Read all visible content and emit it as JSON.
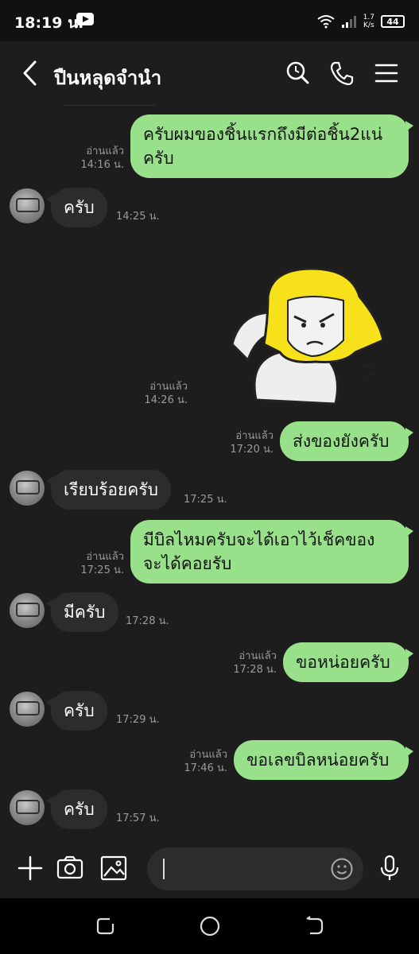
{
  "status_bar": {
    "time": "18:19 น.",
    "speed_value": "1.7",
    "speed_unit": "K/s",
    "battery": "44"
  },
  "header": {
    "title": "ปืนหลุดจำนำ"
  },
  "messages": [
    {
      "id": "m1",
      "from": "me",
      "lines": [
        "ครับผมของชิ้นแรกถึงมีต่อชิ้น2แน่",
        "ครับ"
      ],
      "read": "อ่านแล้ว",
      "time": "14:16 น."
    },
    {
      "id": "m2",
      "from": "them",
      "text": "ครับ",
      "time": "14:25 น."
    },
    {
      "id": "m3",
      "from": "me",
      "type": "sticker",
      "read": "อ่านแล้ว",
      "time": "14:26 น."
    },
    {
      "id": "m4",
      "from": "me",
      "text": "ส่งของยังครับ",
      "read": "อ่านแล้ว",
      "time": "17:20 น."
    },
    {
      "id": "m5",
      "from": "them",
      "text": "เรียบร้อยครับ",
      "time": "17:25 น."
    },
    {
      "id": "m6",
      "from": "me",
      "lines": [
        "มีบิลไหมครับจะได้เอาไว้เช็คของ",
        "จะได้คอยรับ"
      ],
      "read": "อ่านแล้ว",
      "time": "17:25 น."
    },
    {
      "id": "m7",
      "from": "them",
      "text": "มีครับ",
      "time": "17:28 น."
    },
    {
      "id": "m8",
      "from": "me",
      "text": "ขอหน่อยครับ",
      "read": "อ่านแล้ว",
      "time": "17:28 น."
    },
    {
      "id": "m9",
      "from": "them",
      "text": "ครับ",
      "time": "17:29 น."
    },
    {
      "id": "m10",
      "from": "me",
      "text": "ขอเลขบิลหน่อยครับ",
      "read": "อ่านแล้ว",
      "time": "17:46 น."
    },
    {
      "id": "m11",
      "from": "them",
      "text": "ครับ",
      "time": "17:57 น."
    }
  ],
  "input": {
    "value": ""
  },
  "colors": {
    "background": "#1d1d1d",
    "outgoing_bubble": "#98e089",
    "incoming_bubble": "#2c2c2c",
    "meta_text": "#9a9a9a"
  },
  "icons": {
    "header": [
      "back-arrow-icon",
      "search-icon",
      "phone-icon",
      "menu-icon"
    ],
    "input_bar": [
      "plus-icon",
      "camera-icon",
      "image-icon",
      "emoji-icon",
      "microphone-icon"
    ],
    "nav_bar": [
      "recents-icon",
      "home-icon",
      "back-icon"
    ]
  }
}
